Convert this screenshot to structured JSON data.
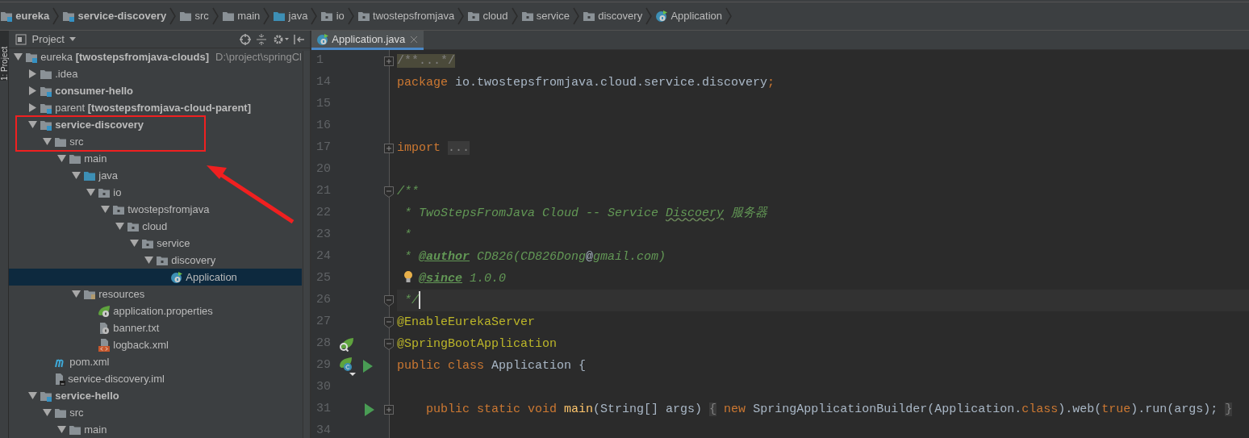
{
  "breadcrumb": [
    {
      "label": "eureka",
      "kind": "module",
      "bold": true
    },
    {
      "label": "service-discovery",
      "kind": "module",
      "bold": true
    },
    {
      "label": "src",
      "kind": "folder",
      "bold": false
    },
    {
      "label": "main",
      "kind": "folder",
      "bold": false
    },
    {
      "label": "java",
      "kind": "source-folder",
      "bold": false
    },
    {
      "label": "io",
      "kind": "package",
      "bold": false
    },
    {
      "label": "twostepsfromjava",
      "kind": "package",
      "bold": false
    },
    {
      "label": "cloud",
      "kind": "package",
      "bold": false
    },
    {
      "label": "service",
      "kind": "package",
      "bold": false
    },
    {
      "label": "discovery",
      "kind": "package",
      "bold": false
    },
    {
      "label": "Application",
      "kind": "spring-class",
      "bold": false
    }
  ],
  "side_tab": "1: Project",
  "project_panel": {
    "title": "Project",
    "tree": [
      {
        "label": "eureka **[twostepsfromjava-clouds]**",
        "location": "D:\\project\\springCl",
        "kind": "module",
        "bold": false,
        "expanded": true,
        "selected": false,
        "children": [
          {
            "label": ".idea",
            "kind": "folder",
            "bold": false,
            "expanded": false,
            "selected": false
          },
          {
            "label": "consumer-hello",
            "kind": "module",
            "bold": true,
            "expanded": false,
            "selected": false
          },
          {
            "label": "parent **[twostepsfromjava-cloud-parent]**",
            "kind": "module",
            "bold": false,
            "expanded": false,
            "selected": false
          },
          {
            "label": "service-discovery",
            "kind": "module",
            "bold": true,
            "expanded": true,
            "selected": false,
            "children": [
              {
                "label": "src",
                "kind": "folder",
                "bold": false,
                "expanded": true,
                "selected": false,
                "children": [
                  {
                    "label": "main",
                    "kind": "folder",
                    "bold": false,
                    "expanded": true,
                    "selected": false,
                    "children": [
                      {
                        "label": "java",
                        "kind": "source-folder",
                        "bold": false,
                        "expanded": true,
                        "selected": false,
                        "children": [
                          {
                            "label": "io",
                            "kind": "package",
                            "bold": false,
                            "expanded": true,
                            "selected": false,
                            "children": [
                              {
                                "label": "twostepsfromjava",
                                "kind": "package",
                                "bold": false,
                                "expanded": true,
                                "selected": false,
                                "children": [
                                  {
                                    "label": "cloud",
                                    "kind": "package",
                                    "bold": false,
                                    "expanded": true,
                                    "selected": false,
                                    "children": [
                                      {
                                        "label": "service",
                                        "kind": "package",
                                        "bold": false,
                                        "expanded": true,
                                        "selected": false,
                                        "children": [
                                          {
                                            "label": "discovery",
                                            "kind": "package",
                                            "bold": false,
                                            "expanded": true,
                                            "selected": false,
                                            "children": [
                                              {
                                                "label": "Application",
                                                "kind": "spring-class",
                                                "bold": false,
                                                "selected": true
                                              }
                                            ]
                                          }
                                        ]
                                      }
                                    ]
                                  }
                                ]
                              }
                            ]
                          }
                        ]
                      },
                      {
                        "label": "resources",
                        "kind": "resources",
                        "bold": false,
                        "expanded": true,
                        "selected": false,
                        "children": [
                          {
                            "label": "application.properties",
                            "kind": "spring-properties",
                            "bold": false,
                            "selected": false
                          },
                          {
                            "label": "banner.txt",
                            "kind": "text-file",
                            "bold": false,
                            "selected": false
                          },
                          {
                            "label": "logback.xml",
                            "kind": "xml-file",
                            "bold": false,
                            "selected": false
                          }
                        ]
                      }
                    ]
                  }
                ]
              },
              {
                "label": "pom.xml",
                "kind": "maven",
                "bold": false,
                "selected": false
              },
              {
                "label": "service-discovery.iml",
                "kind": "iml",
                "bold": false,
                "selected": false
              }
            ]
          },
          {
            "label": "service-hello",
            "kind": "module",
            "bold": true,
            "expanded": true,
            "selected": false,
            "children": [
              {
                "label": "src",
                "kind": "folder",
                "bold": false,
                "expanded": true,
                "selected": false,
                "children": [
                  {
                    "label": "main",
                    "kind": "folder",
                    "bold": false,
                    "expanded": true,
                    "selected": false
                  }
                ]
              }
            ]
          }
        ]
      }
    ]
  },
  "tabs": [
    {
      "label": "Application.java",
      "selected": true
    }
  ],
  "editor": {
    "lines": [
      {
        "number": "1",
        "folded": true,
        "tokens": [
          {
            "kind": "folded",
            "text": "/**...*/"
          }
        ]
      },
      {
        "number": "14",
        "tokens": [
          {
            "kind": "keyword",
            "text": "package"
          },
          {
            "kind": "plain",
            "text": " io.twostepsfromjava.cloud.service.discovery"
          },
          {
            "kind": "keyword",
            "text": ";"
          }
        ]
      },
      {
        "number": "15"
      },
      {
        "number": "16"
      },
      {
        "number": "17",
        "folded": true,
        "tokens": [
          {
            "kind": "keyword",
            "text": "import"
          },
          {
            "kind": "folded",
            "text": "..."
          }
        ]
      },
      {
        "number": "20"
      },
      {
        "number": "21",
        "folded": false,
        "tokens": [
          {
            "kind": "doc",
            "text": "/**"
          }
        ]
      },
      {
        "number": "22",
        "tokens": [
          {
            "kind": "doc",
            "text": " * TwoStepsFromJava Cloud -- Service "
          },
          {
            "kind": "typo",
            "text": "Discoery"
          },
          {
            "kind": "doc",
            "text": " 服务器"
          }
        ]
      },
      {
        "number": "23",
        "tokens": [
          {
            "kind": "doc",
            "text": " *"
          }
        ]
      },
      {
        "number": "24",
        "tokens": [
          {
            "kind": "doc",
            "text": " * "
          },
          {
            "kind": "doctag",
            "text": "@author"
          },
          {
            "kind": "doc",
            "text": " CD826(CD826Dong"
          },
          {
            "kind": "plain",
            "text": "@"
          },
          {
            "kind": "doc",
            "text": "gmail.com)"
          }
        ]
      },
      {
        "number": "25",
        "bulb": true,
        "tokens": [
          {
            "kind": "doctag",
            "text": "@since"
          },
          {
            "kind": "doc",
            "text": " 1.0.0"
          }
        ]
      },
      {
        "number": "26",
        "folded": false,
        "current": true,
        "tokens": [
          {
            "kind": "doc",
            "text": " */"
          }
        ]
      },
      {
        "number": "27",
        "folded": false,
        "tokens": [
          {
            "kind": "annotation",
            "text": "@EnableEurekaServer"
          }
        ]
      },
      {
        "number": "28",
        "folded": false,
        "gutter": [
          {
            "kind": "bean"
          }
        ],
        "tokens": [
          {
            "kind": "annotation",
            "text": "@SpringBootApplication"
          }
        ]
      },
      {
        "number": "29",
        "gutter": [
          {
            "kind": "spring-class"
          },
          {
            "kind": "run"
          }
        ],
        "tokens": [
          {
            "kind": "keyword",
            "text": "public class "
          },
          {
            "kind": "plain",
            "text": "Application {"
          }
        ]
      },
      {
        "number": "30"
      },
      {
        "number": "31",
        "folded": true,
        "gutter": [
          {
            "kind": "run"
          }
        ],
        "tokens": [
          {
            "kind": "keyword",
            "text": "    public static void "
          },
          {
            "kind": "method",
            "text": "main"
          },
          {
            "kind": "plain",
            "text": "(String[] args) "
          },
          {
            "kind": "foldbrace",
            "text": "{"
          },
          {
            "kind": "keyword",
            "text": " new "
          },
          {
            "kind": "plain",
            "text": "SpringApplicationBuilder(Application."
          },
          {
            "kind": "keyword",
            "text": "class"
          },
          {
            "kind": "plain",
            "text": ").web("
          },
          {
            "kind": "keyword",
            "text": "true"
          },
          {
            "kind": "plain",
            "text": ").run(args); "
          },
          {
            "kind": "foldbrace",
            "text": "}"
          }
        ]
      },
      {
        "number": "34"
      }
    ]
  }
}
